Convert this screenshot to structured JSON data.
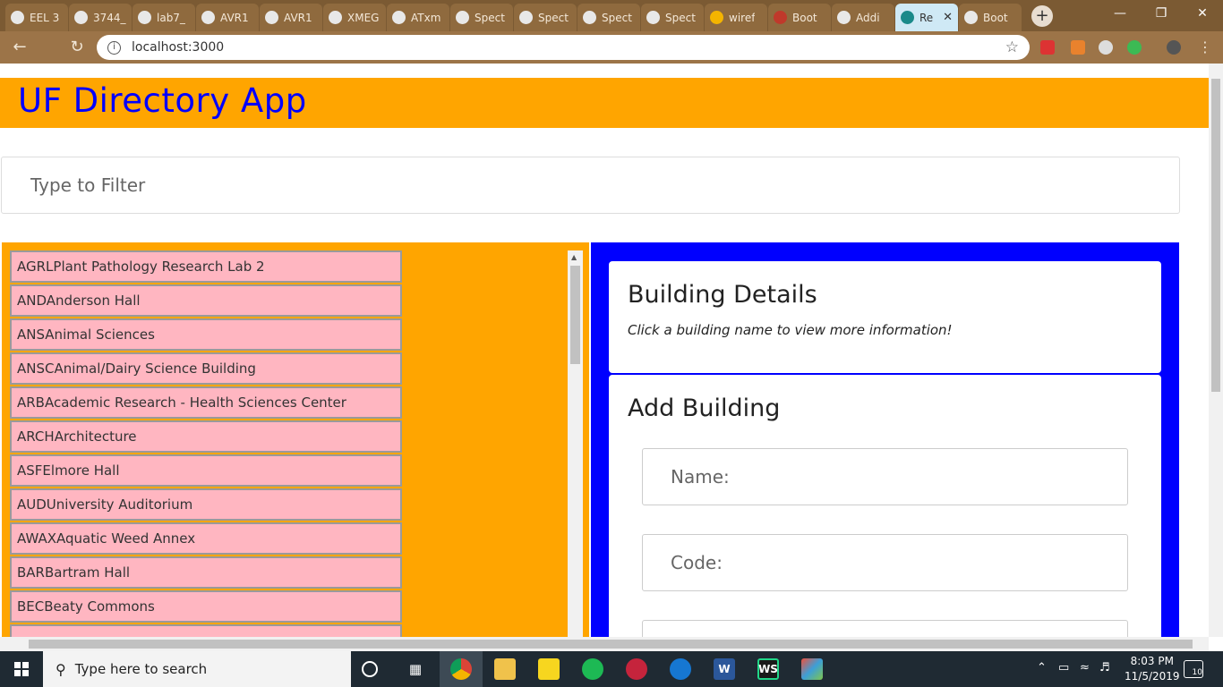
{
  "browser": {
    "tabs": [
      {
        "label": "EEL 3",
        "icon": "globe-icon"
      },
      {
        "label": "3744_",
        "icon": "globe-icon"
      },
      {
        "label": "lab7_",
        "icon": "globe-icon"
      },
      {
        "label": "AVR1",
        "icon": "globe-icon"
      },
      {
        "label": "AVR1",
        "icon": "globe-icon"
      },
      {
        "label": "XMEG",
        "icon": "globe-icon"
      },
      {
        "label": "ATxm",
        "icon": "globe-icon"
      },
      {
        "label": "Spect",
        "icon": "github-icon"
      },
      {
        "label": "Spect",
        "icon": "github-icon"
      },
      {
        "label": "Spect",
        "icon": "github-icon"
      },
      {
        "label": "Spect",
        "icon": "github-icon"
      },
      {
        "label": "wiref",
        "icon": "slides-icon"
      },
      {
        "label": "Boot",
        "icon": "bootstrap-icon"
      },
      {
        "label": "Addi",
        "icon": "github-icon"
      },
      {
        "label": "Re",
        "icon": "react-icon"
      },
      {
        "label": "Boot",
        "icon": "github-icon"
      }
    ],
    "url": "localhost:3000"
  },
  "app": {
    "title": "UF Directory App",
    "filter_placeholder": "Type to Filter",
    "buildings": [
      {
        "code": "AGRL",
        "name": "Plant Pathology Research Lab 2"
      },
      {
        "code": "AND",
        "name": "Anderson Hall"
      },
      {
        "code": "ANS",
        "name": "Animal Sciences"
      },
      {
        "code": "ANSC",
        "name": "Animal/Dairy Science Building"
      },
      {
        "code": "ARB",
        "name": "Academic Research - Health Sciences Center"
      },
      {
        "code": "ARCH",
        "name": "Architecture"
      },
      {
        "code": "ASF",
        "name": "Elmore Hall"
      },
      {
        "code": "AUD",
        "name": "University Auditorium"
      },
      {
        "code": "AWAX",
        "name": "Aquatic Weed Annex"
      },
      {
        "code": "BAR",
        "name": "Bartram Hall"
      },
      {
        "code": "BEC",
        "name": "Beaty Commons"
      }
    ],
    "details": {
      "title": "Building Details",
      "hint": "Click a building name to view more information!"
    },
    "add": {
      "title": "Add Building",
      "name_placeholder": "Name:",
      "code_placeholder": "Code:"
    }
  },
  "taskbar": {
    "search_placeholder": "Type here to search",
    "time": "8:03 PM",
    "date": "11/5/2019",
    "notifications": "10"
  }
}
